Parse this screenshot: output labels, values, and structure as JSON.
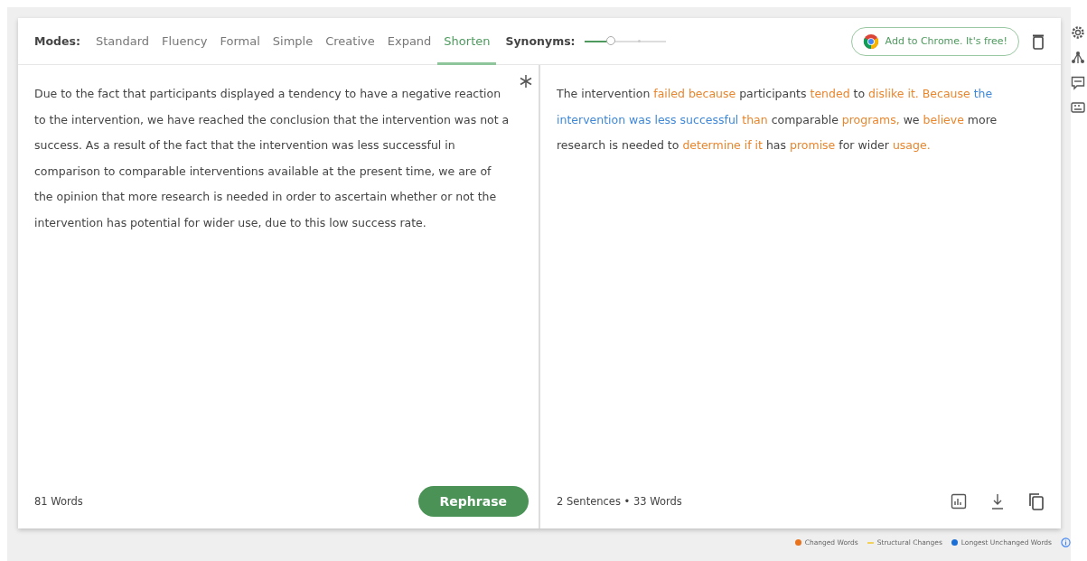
{
  "modes": {
    "label": "Modes:",
    "items": [
      {
        "label": "Standard",
        "selected": false
      },
      {
        "label": "Fluency",
        "selected": false
      },
      {
        "label": "Formal",
        "selected": false
      },
      {
        "label": "Simple",
        "selected": false
      },
      {
        "label": "Creative",
        "selected": false
      },
      {
        "label": "Expand",
        "selected": false
      },
      {
        "label": "Shorten",
        "selected": true
      }
    ]
  },
  "synonyms": {
    "label": "Synonyms:",
    "level": 0.33
  },
  "chrome_button": "Add to Chrome. It's free!",
  "input": {
    "text": "Due to the fact that participants displayed a tendency to have a negative reaction to the intervention, we have reached the conclusion that the intervention was not a success. As a result of the fact that the intervention was less successful in comparison to comparable interventions available at the present time, we are of the opinion that more research is needed in order to ascertain whether or not the intervention has potential for wider use, due to this low success rate.",
    "word_count": "81 Words",
    "button": "Rephrase"
  },
  "output": {
    "segments": [
      {
        "text": "The intervention ",
        "kind": "plain"
      },
      {
        "text": "failed because",
        "kind": "changed"
      },
      {
        "text": " participants ",
        "kind": "plain"
      },
      {
        "text": "tended",
        "kind": "changed"
      },
      {
        "text": " to ",
        "kind": "plain"
      },
      {
        "text": "dislike it. Because",
        "kind": "changed"
      },
      {
        "text": " the intervention was less successful",
        "kind": "unchanged"
      },
      {
        "text": " than",
        "kind": "changed"
      },
      {
        "text": " comparable ",
        "kind": "plain"
      },
      {
        "text": "programs,",
        "kind": "changed"
      },
      {
        "text": " we ",
        "kind": "plain"
      },
      {
        "text": "believe",
        "kind": "changed"
      },
      {
        "text": " more research is needed to ",
        "kind": "plain"
      },
      {
        "text": "determine if it",
        "kind": "changed"
      },
      {
        "text": " has ",
        "kind": "plain"
      },
      {
        "text": "promise",
        "kind": "changed"
      },
      {
        "text": " for wider ",
        "kind": "plain"
      },
      {
        "text": "usage.",
        "kind": "changed"
      }
    ],
    "stats": "2 Sentences • 33 Words"
  },
  "legend": [
    {
      "label": "Changed Words",
      "kind": "dot",
      "color": "#e8731c"
    },
    {
      "label": "Structural Changes",
      "kind": "dash",
      "color": "#f2d25a"
    },
    {
      "label": "Longest Unchanged Words",
      "kind": "dot",
      "color": "#1a6fd6"
    }
  ]
}
